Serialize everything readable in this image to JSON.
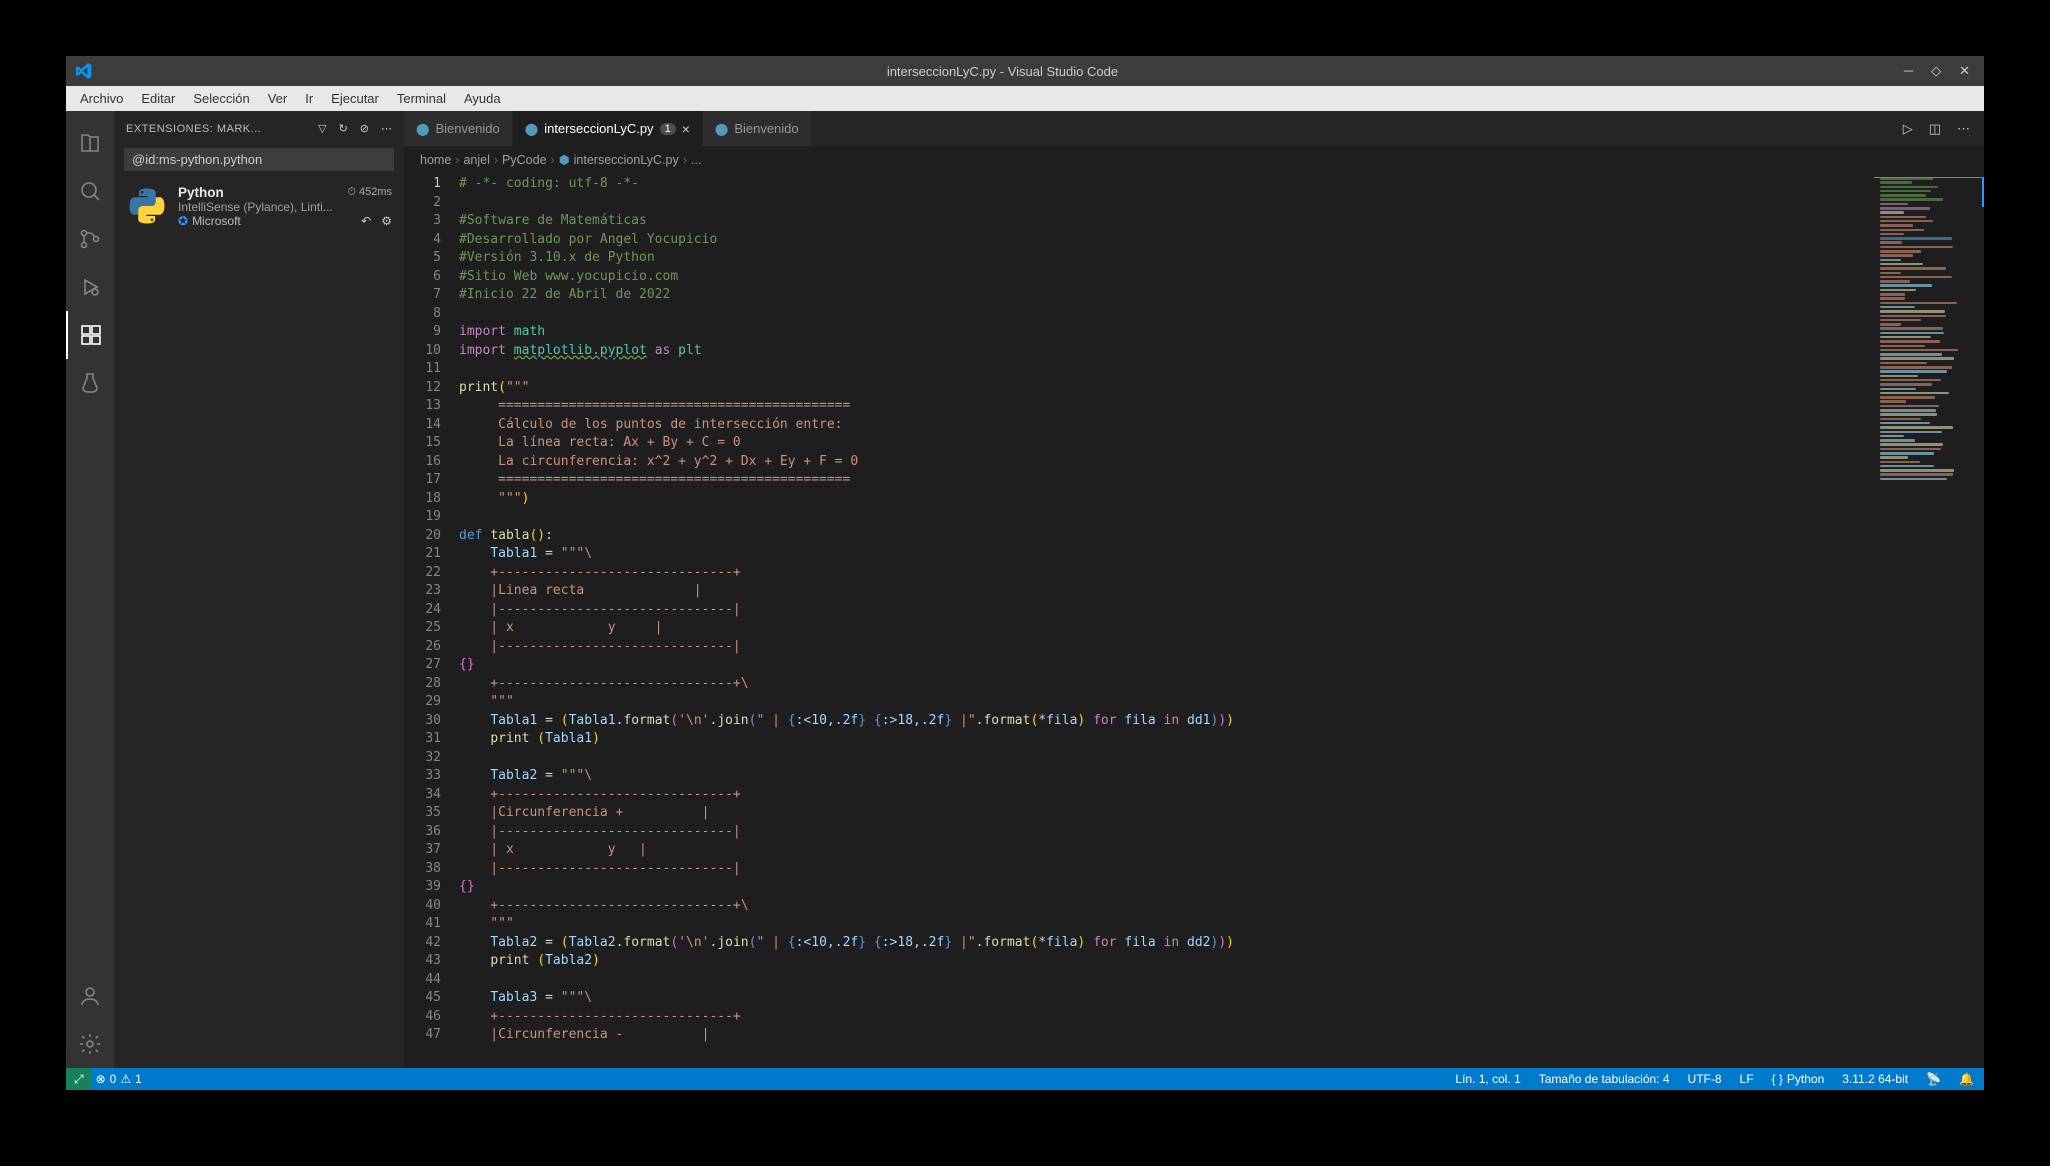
{
  "title": "interseccionLyC.py - Visual Studio Code",
  "menu": [
    "Archivo",
    "Editar",
    "Selección",
    "Ver",
    "Ir",
    "Ejecutar",
    "Terminal",
    "Ayuda"
  ],
  "sidebar": {
    "title": "EXTENSIONES: MARK...",
    "search_value": "@id:ms-python.python",
    "ext": {
      "name": "Python",
      "time": "⏱ 452ms",
      "desc": "IntelliSense (Pylance), Linti...",
      "publisher": "Microsoft"
    }
  },
  "tabs": [
    {
      "label": "Bienvenido",
      "icon_color": "#519aba",
      "active": false,
      "dirty": false
    },
    {
      "label": "interseccionLyC.py",
      "icon_color": "#519aba",
      "active": true,
      "dirty": true,
      "dirty_badge": "1"
    },
    {
      "label": "Bienvenido",
      "icon_color": "#519aba",
      "active": false,
      "dirty": false
    }
  ],
  "breadcrumb": [
    "home",
    "anjel",
    "PyCode",
    "interseccionLyC.py",
    "..."
  ],
  "statusbar": {
    "errors": "0",
    "warnings": "1",
    "cursor": "Lín. 1, col. 1",
    "spaces": "Tamaño de tabulación: 4",
    "encoding": "UTF-8",
    "eol": "LF",
    "lang": "Python",
    "interp": "3.11.2 64-bit"
  },
  "code_lines": [
    {
      "n": 1,
      "h": "<span class='c-comment'># -*- coding: utf-8 -*-</span>"
    },
    {
      "n": 2,
      "h": ""
    },
    {
      "n": 3,
      "h": "<span class='c-comment'>#Software de Matemáticas</span>"
    },
    {
      "n": 4,
      "h": "<span class='c-comment'>#Desarrollado por Angel Yocupicio</span>"
    },
    {
      "n": 5,
      "h": "<span class='c-comment'>#Versión 3.10.x de Python</span>"
    },
    {
      "n": 6,
      "h": "<span class='c-comment'>#Sitio Web www.yocupicio.com</span>"
    },
    {
      "n": 7,
      "h": "<span class='c-comment'>#Inicio 22 de Abril de 2022</span>"
    },
    {
      "n": 8,
      "h": ""
    },
    {
      "n": 9,
      "h": "<span class='c-keyword'>import</span> <span class='c-mod'>math</span>"
    },
    {
      "n": 10,
      "h": "<span class='c-keyword'>import</span> <span class='c-mod' style='text-decoration:underline wavy #6a9955;'>matplotlib.pyplot</span> <span class='c-keyword'>as</span> <span class='c-mod'>plt</span>"
    },
    {
      "n": 11,
      "h": ""
    },
    {
      "n": 12,
      "h": "<span class='c-func'>print</span><span class='c-brace'>(</span><span class='c-str'>\"\"\"</span>"
    },
    {
      "n": 13,
      "h": "<span class='c-str'>     =============================================</span>"
    },
    {
      "n": 14,
      "h": "<span class='c-str'>     Cálculo de los puntos de intersección entre:</span>"
    },
    {
      "n": 15,
      "h": "<span class='c-str'>     La línea recta: Ax + By + C = 0</span>"
    },
    {
      "n": 16,
      "h": "<span class='c-str'>     La circunferencia: x^2 + y^2 + Dx + Ey + F = 0</span>"
    },
    {
      "n": 17,
      "h": "<span class='c-str'>     =============================================</span>"
    },
    {
      "n": 18,
      "h": "<span class='c-str'>     \"\"\"</span><span class='c-brace'>)</span>"
    },
    {
      "n": 19,
      "h": ""
    },
    {
      "n": 20,
      "h": "<span class='c-keyword2'>def</span> <span class='c-func'>tabla</span><span class='c-brace'>()</span>:"
    },
    {
      "n": 21,
      "h": "    <span class='c-var'>Tabla1</span> = <span class='c-str'>\"\"\"\\</span>"
    },
    {
      "n": 22,
      "h": "<span class='c-str'>    +------------------------------+</span>"
    },
    {
      "n": 23,
      "h": "<span class='c-str'>    |Linea recta              |</span>"
    },
    {
      "n": 24,
      "h": "<span class='c-str'>    |------------------------------|</span>"
    },
    {
      "n": 25,
      "h": "<span class='c-str'>    | x            y     |</span>"
    },
    {
      "n": 26,
      "h": "<span class='c-str'>    |------------------------------|</span>"
    },
    {
      "n": 27,
      "h": "<span class='c-braceP'>{}</span>"
    },
    {
      "n": 28,
      "h": "<span class='c-str'>    +------------------------------+\\</span>"
    },
    {
      "n": 29,
      "h": "<span class='c-str'>    \"\"\"</span>"
    },
    {
      "n": 30,
      "h": "    <span class='c-var'>Tabla1</span> = <span class='c-brace'>(</span><span class='c-var'>Tabla1</span>.<span class='c-func'>format</span><span class='c-braceP'>(</span><span class='c-str'>'\\n'</span>.<span class='c-func'>join</span><span class='c-keyword2'>(</span><span class='c-str'>\" | </span><span class='c-keyword2'>{</span><span class='c-var'>:&lt;10,.2f</span><span class='c-keyword2'>}</span><span class='c-str'> </span><span class='c-keyword2'>{</span><span class='c-var'>:&gt;18,.2f</span><span class='c-keyword2'>}</span><span class='c-str'> |\"</span>.<span class='c-func'>format</span><span class='c-brace'>(</span>*<span class='c-var'>fila</span><span class='c-brace'>)</span> <span class='c-keyword'>for</span> <span class='c-var'>fila</span> <span class='c-keyword'>in</span> <span class='c-var'>dd1</span><span class='c-keyword2'>)</span><span class='c-braceP'>)</span><span class='c-brace'>)</span>"
    },
    {
      "n": 31,
      "h": "    <span class='c-func'>print</span> <span class='c-brace'>(</span><span class='c-var'>Tabla1</span><span class='c-brace'>)</span>"
    },
    {
      "n": 32,
      "h": ""
    },
    {
      "n": 33,
      "h": "    <span class='c-var'>Tabla2</span> = <span class='c-str'>\"\"\"\\</span>"
    },
    {
      "n": 34,
      "h": "<span class='c-str'>    +------------------------------+</span>"
    },
    {
      "n": 35,
      "h": "<span class='c-str'>    |Circunferencia +          |</span>"
    },
    {
      "n": 36,
      "h": "<span class='c-str'>    |------------------------------|</span>"
    },
    {
      "n": 37,
      "h": "<span class='c-str'>    | x            y   |</span>"
    },
    {
      "n": 38,
      "h": "<span class='c-str'>    |------------------------------|</span>"
    },
    {
      "n": 39,
      "h": "<span class='c-braceP'>{}</span>"
    },
    {
      "n": 40,
      "h": "<span class='c-str'>    +------------------------------+\\</span>"
    },
    {
      "n": 41,
      "h": "<span class='c-str'>    \"\"\"</span>"
    },
    {
      "n": 42,
      "h": "    <span class='c-var'>Tabla2</span> = <span class='c-brace'>(</span><span class='c-var'>Tabla2</span>.<span class='c-func'>format</span><span class='c-braceP'>(</span><span class='c-str'>'\\n'</span>.<span class='c-func'>join</span><span class='c-keyword2'>(</span><span class='c-str'>\" | </span><span class='c-keyword2'>{</span><span class='c-var'>:&lt;10,.2f</span><span class='c-keyword2'>}</span><span class='c-str'> </span><span class='c-keyword2'>{</span><span class='c-var'>:&gt;18,.2f</span><span class='c-keyword2'>}</span><span class='c-str'> |\"</span>.<span class='c-func'>format</span><span class='c-brace'>(</span>*<span class='c-var'>fila</span><span class='c-brace'>)</span> <span class='c-keyword'>for</span> <span class='c-var'>fila</span> <span class='c-keyword'>in</span> <span class='c-var'>dd2</span><span class='c-keyword2'>)</span><span class='c-braceP'>)</span><span class='c-brace'>)</span>"
    },
    {
      "n": 43,
      "h": "    <span class='c-func'>print</span> <span class='c-brace'>(</span><span class='c-var'>Tabla2</span><span class='c-brace'>)</span>"
    },
    {
      "n": 44,
      "h": ""
    },
    {
      "n": 45,
      "h": "    <span class='c-var'>Tabla3</span> = <span class='c-str'>\"\"\"\\</span>"
    },
    {
      "n": 46,
      "h": "<span class='c-str'>    +------------------------------+</span>"
    },
    {
      "n": 47,
      "h": "<span class='c-str'>    |Circunferencia -          |</span>"
    }
  ],
  "minimap_colors": [
    "#6a9955",
    "#6a9955",
    "#6a9955",
    "#6a9955",
    "#6a9955",
    "#6a9955",
    "#c586c0",
    "#c586c0",
    "#dcdcaa",
    "#ce9178",
    "#ce9178",
    "#ce9178",
    "#ce9178",
    "#ce9178",
    "#569cd6",
    "#ce9178",
    "#ce9178",
    "#ce9178",
    "#ce9178",
    "#9cdcfe",
    "#dcdcaa",
    "#ce9178",
    "#ce9178",
    "#ce9178",
    "#ce9178",
    "#9cdcfe",
    "#dcdcaa",
    "#ce9178",
    "#ce9178",
    "#ce9178",
    "#9cdcfe",
    "#dcdcaa",
    "#ce9178",
    "#ce9178",
    "#ce9178",
    "#ce9178",
    "#9cdcfe",
    "#dcdcaa",
    "#ce9178",
    "#ce9178",
    "#ce9178",
    "#9cdcfe",
    "#dcdcaa",
    "#ce9178",
    "#ce9178",
    "#9cdcfe",
    "#dcdcaa",
    "#ce9178",
    "#ce9178",
    "#9cdcfe",
    "#dcdcaa",
    "#ce9178",
    "#ce9178",
    "#ce9178",
    "#9cdcfe",
    "#dcdcaa",
    "#ce9178",
    "#9cdcfe",
    "#dcdcaa",
    "#9cdcfe",
    "#dcdcaa",
    "#9cdcfe",
    "#dcdcaa",
    "#ce9178",
    "#9cdcfe",
    "#dcdcaa",
    "#ce9178",
    "#9cdcfe",
    "#dcdcaa",
    "#ce9178",
    "#9cdcfe"
  ]
}
